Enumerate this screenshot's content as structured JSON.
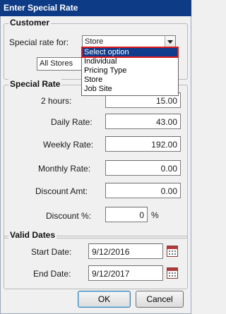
{
  "window": {
    "title": "Enter Special Rate"
  },
  "customer": {
    "title": "Customer",
    "rate_for_label": "Special rate for:",
    "rate_for_value": "Store",
    "stores_value": "All Stores",
    "dropdown_options": [
      "Select option",
      "Individual",
      "Pricing Type",
      "Store",
      "Job Site"
    ],
    "dropdown_highlighted": "Select option"
  },
  "special_rate": {
    "title": "Special Rate",
    "hours_label": "2 hours:",
    "hours_value": "15.00",
    "daily_label": "Daily Rate:",
    "daily_value": "43.00",
    "weekly_label": "Weekly Rate:",
    "weekly_value": "192.00",
    "monthly_label": "Monthly Rate:",
    "monthly_value": "0.00",
    "discount_amt_label": "Discount Amt:",
    "discount_amt_value": "0.00",
    "discount_pct_label": "Discount %:",
    "discount_pct_value": "0",
    "percent_sign": "%"
  },
  "valid_dates": {
    "title": "Valid Dates",
    "start_label": "Start Date:",
    "start_value": "9/12/2016",
    "end_label": "End Date:",
    "end_value": "9/12/2017"
  },
  "buttons": {
    "ok": "OK",
    "cancel": "Cancel"
  },
  "colors": {
    "titlebar": "#0d3b86",
    "selection": "#0f3c8c",
    "highlight_outline": "#e01b1b"
  }
}
